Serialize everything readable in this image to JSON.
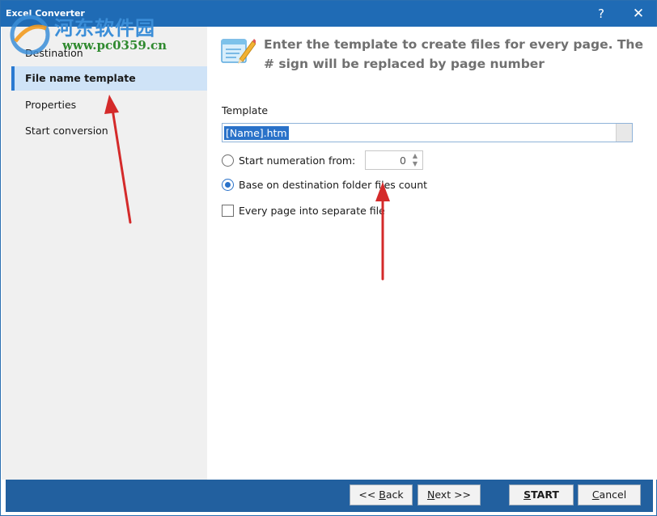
{
  "window": {
    "title": "Excel Converter",
    "help_glyph": "?",
    "close_glyph": "✕"
  },
  "watermark": {
    "cn_text": "河东软件园",
    "url": "www.pc0359.cn"
  },
  "sidebar": {
    "items": [
      {
        "label": "Destination"
      },
      {
        "label": "File name template"
      },
      {
        "label": "Properties"
      },
      {
        "label": "Start conversion"
      }
    ]
  },
  "content": {
    "header_text": "Enter the template to create files for every page. The # sign will be replaced by page number",
    "template_label": "Template",
    "template_value": "[Name].htm",
    "options": {
      "start_numeration": {
        "label": "Start numeration from:",
        "value": "0",
        "checked": false
      },
      "base_on_destination": {
        "label": "Base on destination folder files count",
        "checked": true
      },
      "every_page": {
        "label": "Every page into separate file",
        "checked": false
      }
    }
  },
  "footer": {
    "back": {
      "prefix": "<< ",
      "mnemonic": "B",
      "rest": "ack"
    },
    "next": {
      "mnemonic": "N",
      "rest": "ext >>"
    },
    "start": {
      "mnemonic": "S",
      "rest": "TART"
    },
    "cancel": {
      "mnemonic": "C",
      "rest": "ancel"
    }
  },
  "colors": {
    "titlebar": "#1f6bb5",
    "footer": "#22609f",
    "accent": "#2a72c9",
    "annotation_arrow": "#d42a2a"
  },
  "icons": [
    "question-icon",
    "close-icon",
    "notepad-pencil-icon",
    "spin-up-icon",
    "spin-down-icon",
    "dropdown-icon"
  ]
}
